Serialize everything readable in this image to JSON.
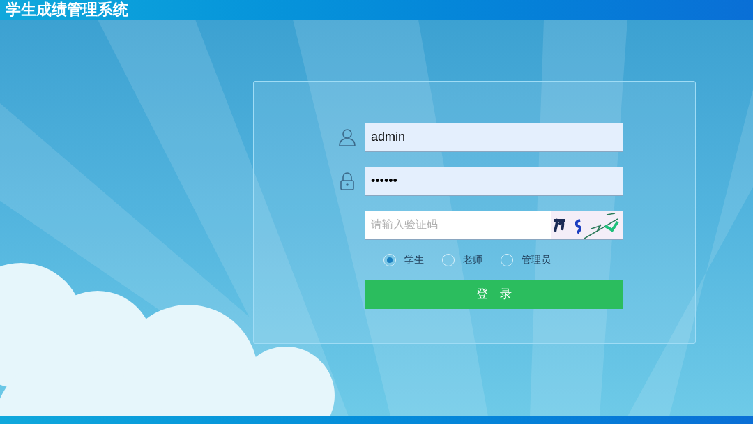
{
  "header": {
    "title": "学生成绩管理系统"
  },
  "login": {
    "username": {
      "value": "admin"
    },
    "password": {
      "value": "••••••"
    },
    "captcha": {
      "placeholder": "请输入验证码"
    },
    "roles": [
      {
        "label": "学生",
        "selected": true
      },
      {
        "label": "老师",
        "selected": false
      },
      {
        "label": "管理员",
        "selected": false
      }
    ],
    "submit": "登　录"
  }
}
